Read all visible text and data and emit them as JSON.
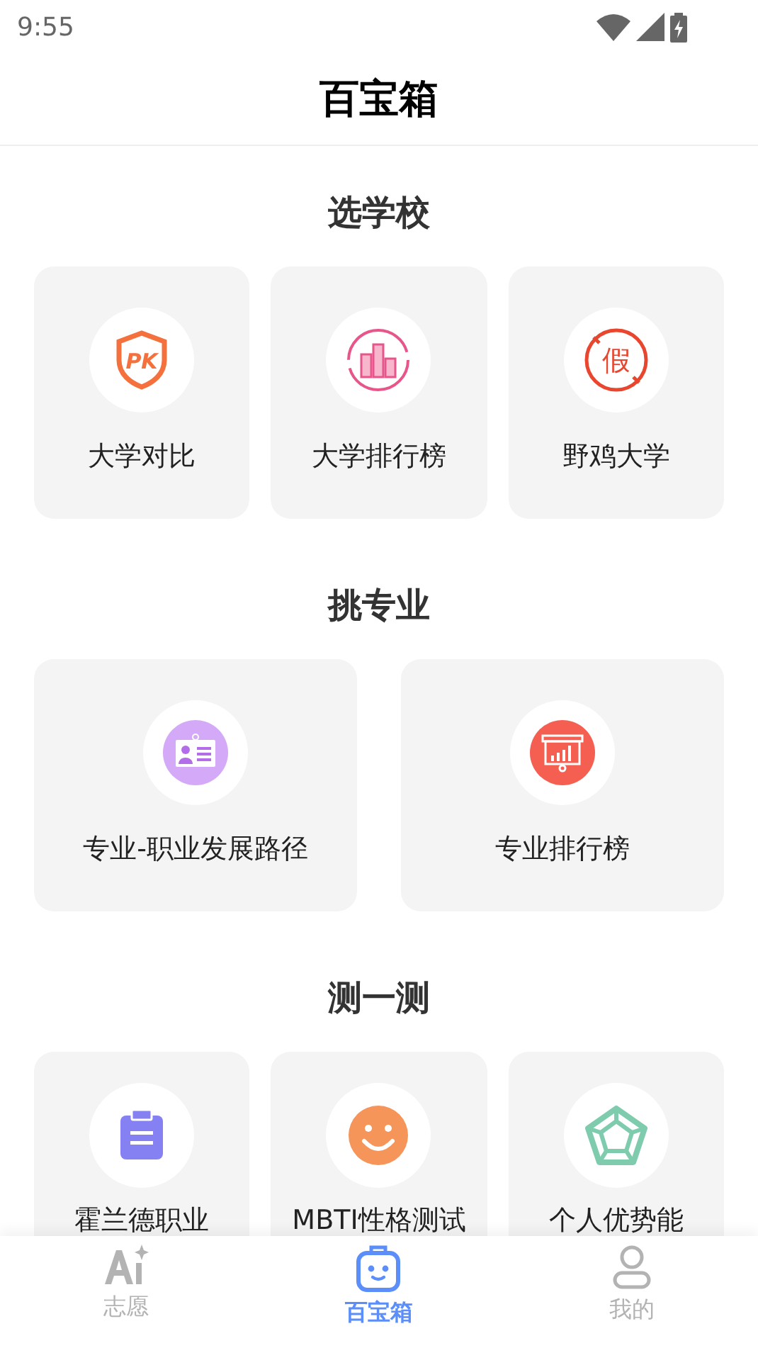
{
  "status_bar": {
    "time": "9:55"
  },
  "header": {
    "title": "百宝箱"
  },
  "sections": [
    {
      "title": "选学校",
      "items": [
        {
          "label": "大学对比",
          "icon_text": "PK"
        },
        {
          "label": "大学排行榜"
        },
        {
          "label": "野鸡大学",
          "icon_text": "假"
        }
      ]
    },
    {
      "title": "挑专业",
      "items": [
        {
          "label": "专业-职业发展路径"
        },
        {
          "label": "专业排行榜"
        }
      ]
    },
    {
      "title": "测一测",
      "items": [
        {
          "label": "霍兰德职业"
        },
        {
          "label": "MBTI性格测试"
        },
        {
          "label": "个人优势能"
        }
      ]
    }
  ],
  "tab_bar": [
    {
      "label": "志愿",
      "selected": false
    },
    {
      "label": "百宝箱",
      "selected": true
    },
    {
      "label": "我的",
      "selected": false
    }
  ]
}
